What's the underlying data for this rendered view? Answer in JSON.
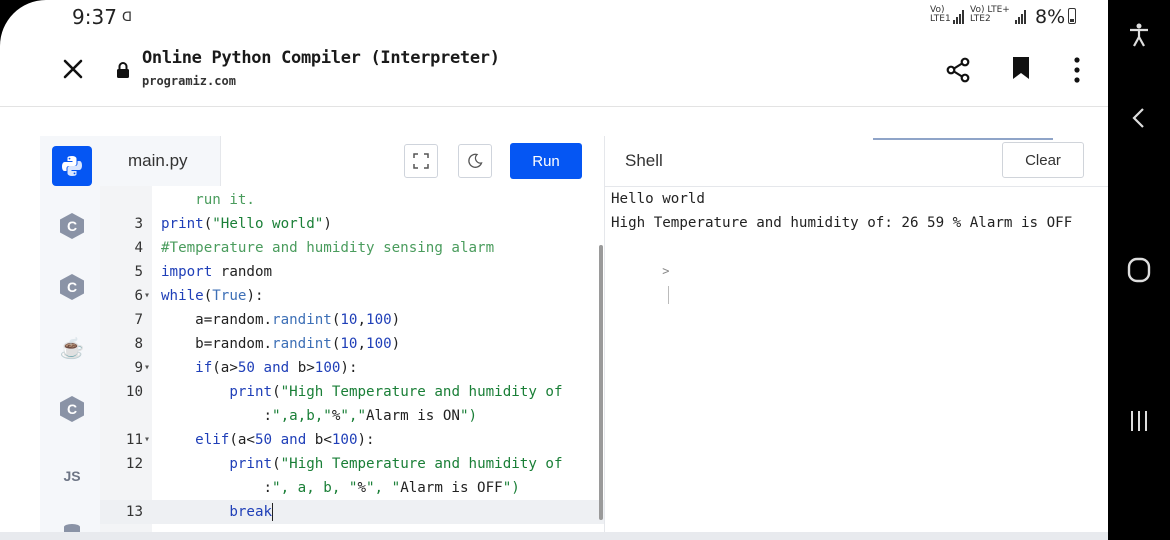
{
  "status_bar": {
    "time": "9:37",
    "sim1": {
      "top": "Vo)",
      "bottom": "LTE1"
    },
    "sim2": {
      "top": "Vo) LTE+",
      "bottom": "LTE2"
    },
    "battery": "8%"
  },
  "browser": {
    "title": "Online Python Compiler (Interpreter)",
    "url": "programiz.com"
  },
  "sidebar": {
    "items": [
      {
        "name": "python"
      },
      {
        "name": "c",
        "label": "C"
      },
      {
        "name": "cpp",
        "label": "C"
      },
      {
        "name": "java",
        "label": "☕"
      },
      {
        "name": "csharp",
        "label": "C"
      },
      {
        "name": "javascript",
        "label": "JS"
      },
      {
        "name": "sql"
      }
    ]
  },
  "editor": {
    "tab": "main.py",
    "run_label": "Run",
    "lines": [
      {
        "n": "",
        "fold": "",
        "html": "    run it."
      },
      {
        "n": "3",
        "fold": "",
        "html": "print(\"Hello world\")"
      },
      {
        "n": "4",
        "fold": "",
        "html": "#Temperature and humidity sensing alarm"
      },
      {
        "n": "5",
        "fold": "",
        "html": "import random"
      },
      {
        "n": "6",
        "fold": "▾",
        "html": "while(True):"
      },
      {
        "n": "7",
        "fold": "",
        "html": "    a=random.randint(10,100)"
      },
      {
        "n": "8",
        "fold": "",
        "html": "    b=random.randint(10,100)"
      },
      {
        "n": "9",
        "fold": "▾",
        "html": "    if(a>50 and b>100):"
      },
      {
        "n": "10",
        "fold": "",
        "html": "        print(\"High Temperature and humidity of"
      },
      {
        "n": "",
        "fold": "",
        "html": "            :\",a,b,\"%\",\"Alarm is ON\")"
      },
      {
        "n": "11",
        "fold": "▾",
        "html": "    elif(a<50 and b<100):"
      },
      {
        "n": "12",
        "fold": "",
        "html": "        print(\"High Temperature and humidity of"
      },
      {
        "n": "",
        "fold": "",
        "html": "            :\", a, b, \"%\", \"Alarm is OFF\")"
      },
      {
        "n": "13",
        "fold": "",
        "html": "        break"
      }
    ]
  },
  "shell": {
    "title": "Shell",
    "clear_label": "Clear",
    "output": [
      "Hello world",
      "High Temperature and humidity of: 26 59 % Alarm is OFF"
    ],
    "prompt": ">"
  }
}
